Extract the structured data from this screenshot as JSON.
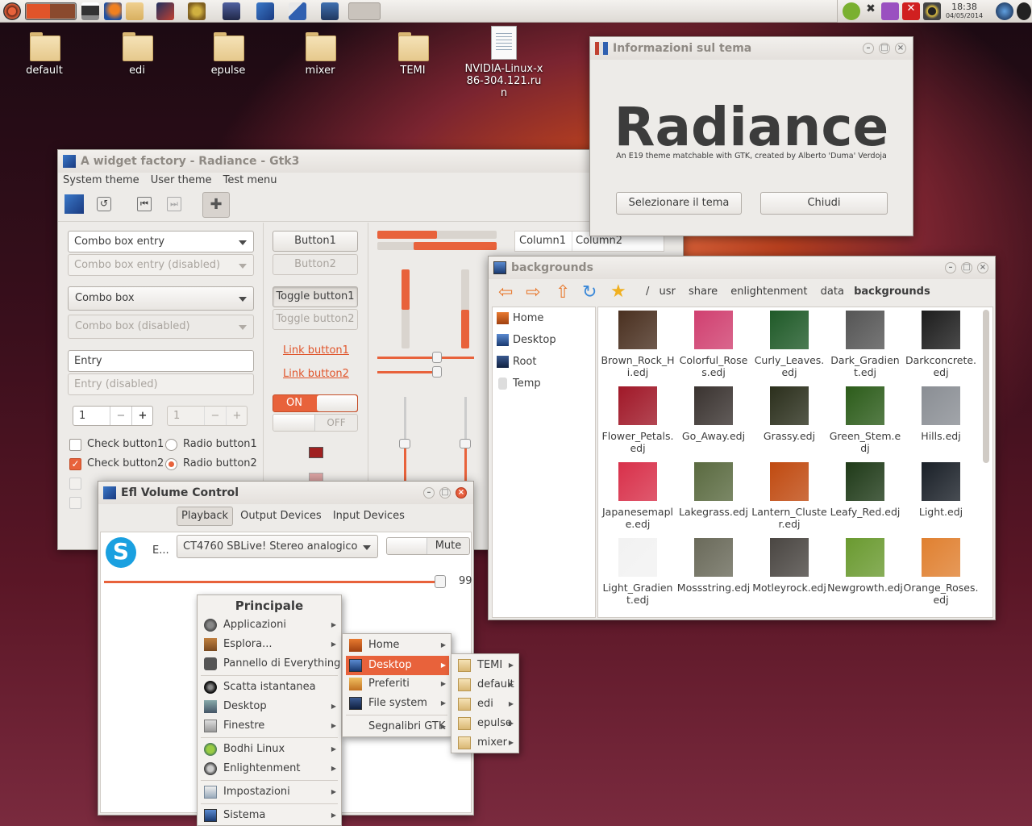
{
  "taskbar": {
    "clock_time": "18:38",
    "clock_date": "04/05/2014"
  },
  "desktop_icons": [
    "default",
    "edi",
    "epulse",
    "mixer",
    "TEMI",
    "NVIDIA-Linux-x86-304.121.run"
  ],
  "theme_dialog": {
    "title": "Informazioni sul tema",
    "theme_name": "Radiance",
    "description": "An E19 theme matchable with GTK, created by Alberto 'Duma' Verdoja",
    "select_button": "Selezionare il tema",
    "close_button": "Chiudi"
  },
  "widget_factory": {
    "title": "A widget factory - Radiance - Gtk3",
    "menus": [
      "System theme",
      "User theme",
      "Test menu"
    ],
    "combo_entry": "Combo box entry",
    "combo_entry_disabled": "Combo box entry (disabled)",
    "combo": "Combo box",
    "combo_disabled": "Combo box (disabled)",
    "entry": "Entry",
    "entry_disabled": "Entry (disabled)",
    "spin1": "1",
    "spin2": "1",
    "check1": "Check button1",
    "check2": "Check button2",
    "radio1": "Radio button1",
    "radio2": "Radio button2",
    "button1": "Button1",
    "button2": "Button2",
    "toggle1": "Toggle button1",
    "toggle2": "Toggle button2",
    "link1": "Link button1",
    "link2": "Link button2",
    "switch_on": "ON",
    "switch_off": "OFF",
    "column1": "Column1",
    "column2": "Column2",
    "progress": [
      0.5,
      0.3
    ]
  },
  "file_manager": {
    "title": "backgrounds",
    "path": [
      "/",
      "usr",
      "share",
      "enlightenment",
      "data",
      "backgrounds"
    ],
    "places": [
      "Home",
      "Desktop",
      "Root",
      "Temp"
    ],
    "files": [
      "Brown_Rock_Hi.edj",
      "Colorful_Roses.edj",
      "Curly_Leaves.edj",
      "Dark_Gradient.edj",
      "Darkconcrete.edj",
      "Flower_Petals.edj",
      "Go_Away.edj",
      "Grassy.edj",
      "Green_Stem.edj",
      "Hills.edj",
      "Japanesemaple.edj",
      "Lakegrass.edj",
      "Lantern_Cluster.edj",
      "Leafy_Red.edj",
      "Light.edj",
      "Light_Gradient.edj",
      "Mossstring.edj",
      "Motleyrock.edj",
      "Newgrowth.edj",
      "Orange_Roses.edj"
    ],
    "thumb_colors": [
      "#4a3020",
      "#d04070",
      "#1f5a28",
      "#555555",
      "#1d1d1d",
      "#a01828",
      "#3a3330",
      "#2b2f1c",
      "#2c5c1a",
      "#8a8e94",
      "#d8304a",
      "#5a6a40",
      "#c04a10",
      "#1f3a18",
      "#1a2028",
      "#f2f2f2",
      "#6a6a5a",
      "#4a4642",
      "#6a9a30",
      "#e08030"
    ]
  },
  "volume": {
    "title": "Efl Volume Control",
    "tabs": [
      "Playback",
      "Output Devices",
      "Input Devices"
    ],
    "app_label": "E...",
    "device": "CT4760 SBLive! Stereo analogico",
    "mute": "Mute",
    "level": "99"
  },
  "menu_main": {
    "title": "Principale",
    "items": [
      "Applicazioni",
      "Esplora...",
      "Pannello di Everything",
      "Scatta istantanea",
      "Desktop",
      "Finestre",
      "Bodhi Linux",
      "Enlightenment",
      "Impostazioni",
      "Sistema"
    ]
  },
  "menu_explore": [
    "Home",
    "Desktop",
    "Preferiti",
    "File system",
    "Segnalibri GTK"
  ],
  "menu_desktop": [
    "TEMI",
    "default",
    "edi",
    "epulse",
    "mixer"
  ]
}
